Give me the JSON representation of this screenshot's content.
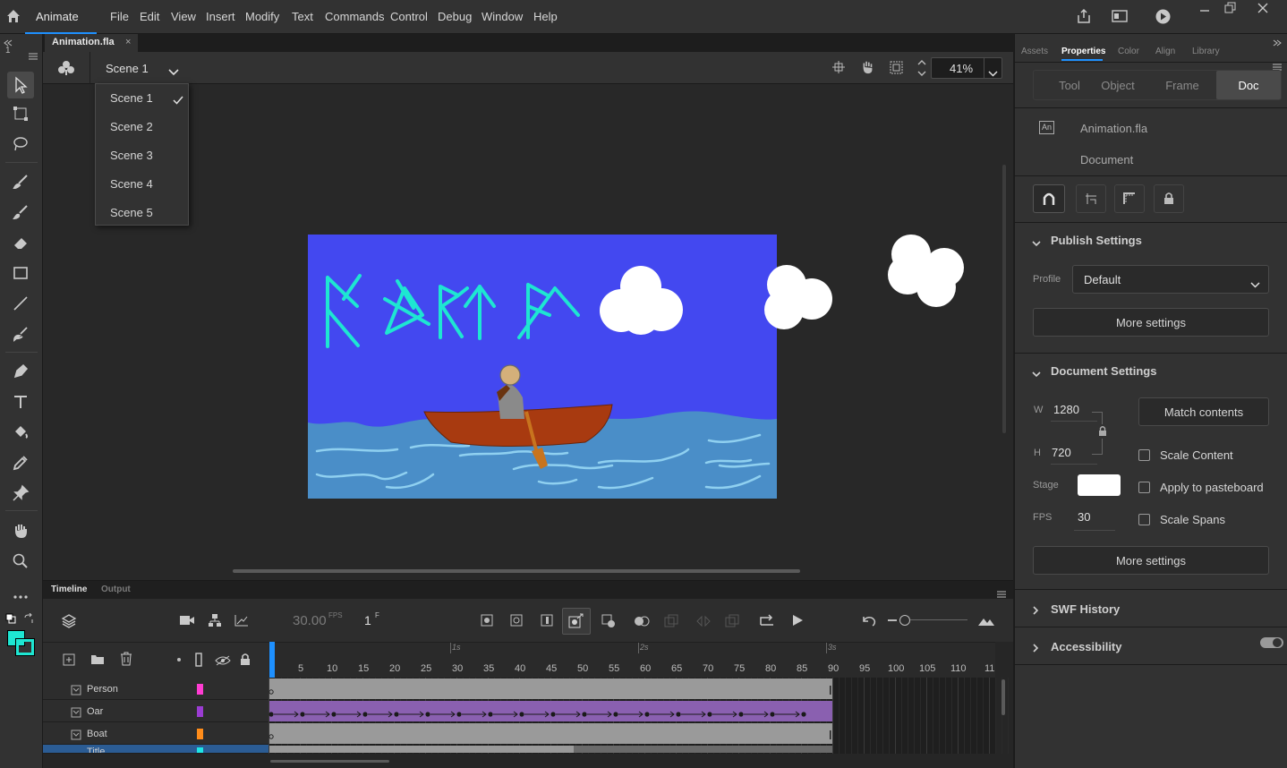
{
  "app": {
    "name": "Animate"
  },
  "menu": [
    "File",
    "Edit",
    "View",
    "Insert",
    "Modify",
    "Text",
    "Commands",
    "Control",
    "Debug",
    "Window",
    "Help"
  ],
  "document_tab": {
    "title": "Animation.fla",
    "close": "×"
  },
  "scene_bar": {
    "current": "Scene 1",
    "zoom": "41%"
  },
  "scene_dropdown": {
    "items": [
      "Scene 1",
      "Scene 2",
      "Scene 3",
      "Scene 4",
      "Scene 5"
    ],
    "checked": "Scene 1"
  },
  "toolbar_left": {
    "top_label": "1"
  },
  "timeline": {
    "tabs": [
      "Timeline",
      "Output"
    ],
    "fps": "30.00",
    "fps_unit": "FPS",
    "current_frame": "1",
    "frame_unit": "F",
    "seconds": [
      "1s",
      "2s",
      "3s"
    ],
    "frame_numbers": [
      "5",
      "10",
      "15",
      "20",
      "25",
      "30",
      "35",
      "40",
      "45",
      "50",
      "55",
      "60",
      "65",
      "70",
      "75",
      "80",
      "85",
      "90",
      "95",
      "100",
      "105",
      "110",
      "11"
    ],
    "layers": [
      {
        "name": "Person",
        "color": "#ff3cd2"
      },
      {
        "name": "Oar",
        "color": "#9b3cd2"
      },
      {
        "name": "Boat",
        "color": "#ff8c1a"
      },
      {
        "name": "Title",
        "color": "#1ee6e6"
      }
    ]
  },
  "right_panel": {
    "tabs": [
      "Assets",
      "Properties",
      "Color",
      "Align",
      "Library"
    ],
    "active_tab": "Properties",
    "segments": [
      "Tool",
      "Object",
      "Frame",
      "Doc"
    ],
    "active_segment": "Doc",
    "doc_icon": "An",
    "file_name": "Animation.fla",
    "doc_type": "Document",
    "publish": {
      "title": "Publish Settings",
      "profile_label": "Profile",
      "profile_value": "Default",
      "more_settings": "More settings"
    },
    "document_settings": {
      "title": "Document Settings",
      "w_label": "W",
      "w_value": "1280",
      "h_label": "H",
      "h_value": "720",
      "match_contents": "Match contents",
      "scale_content": "Scale Content",
      "stage_label": "Stage",
      "stage_color": "#ffffff",
      "apply_pasteboard": "Apply to pasteboard",
      "fps_label": "FPS",
      "fps_value": "30",
      "scale_spans": "Scale Spans",
      "more_settings": "More settings"
    },
    "swf_history": "SWF History",
    "accessibility": "Accessibility"
  },
  "colors": {
    "stroke": "#1ee6d2",
    "fill": "#1ee6d2",
    "canvas_bg": "#4348f0",
    "water": "#4a8ec8"
  }
}
